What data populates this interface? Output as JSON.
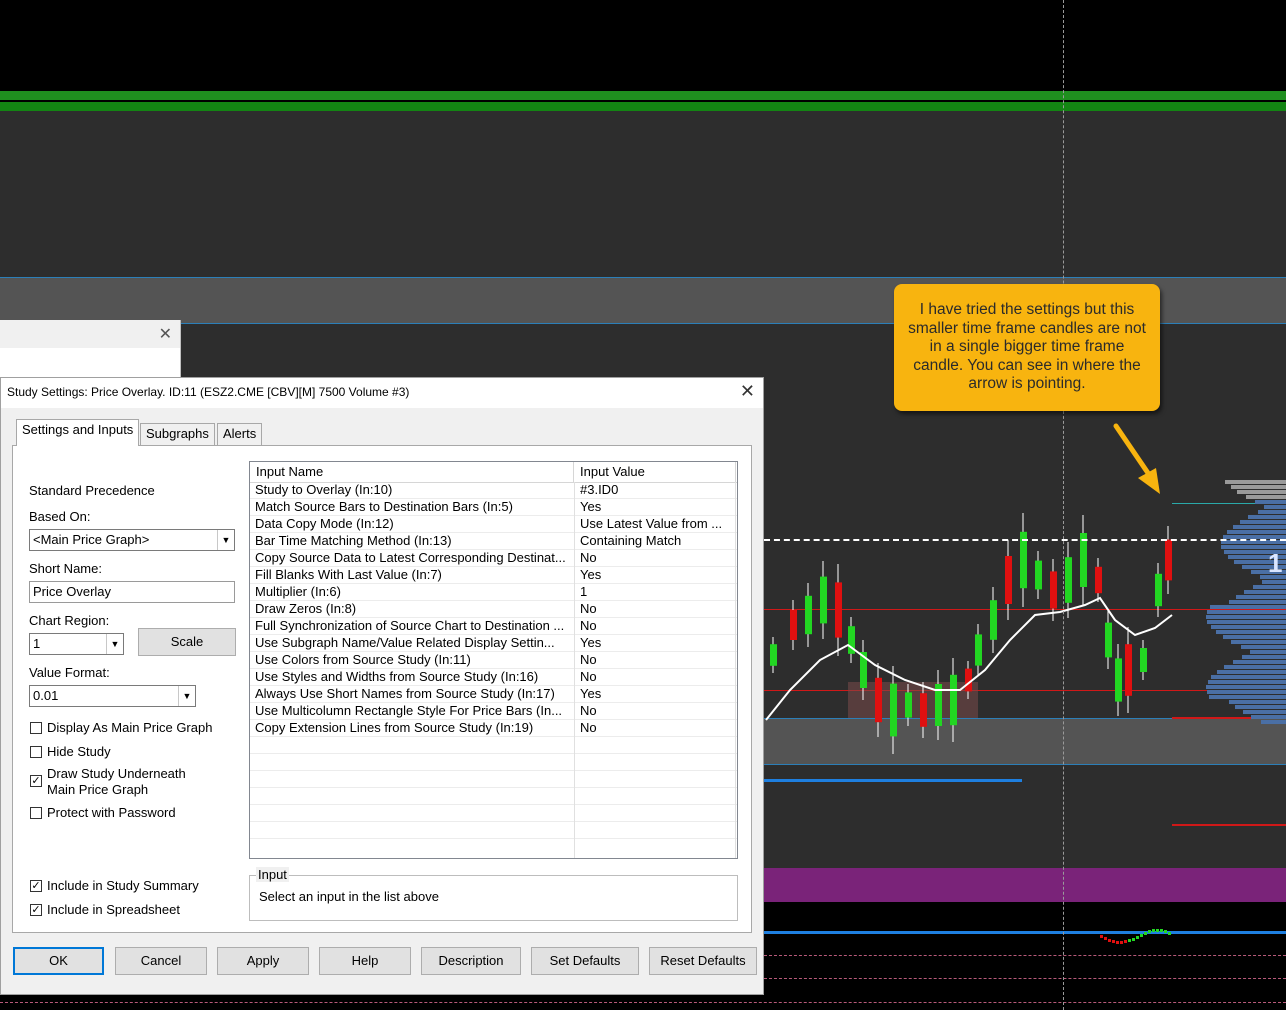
{
  "dialog": {
    "title": "Study Settings: Price Overlay. ID:11 (ESZ2.CME [CBV][M]  7500 Volume  #3)",
    "close_glyph": "✕",
    "tabs": [
      "Settings and Inputs",
      "Subgraphs",
      "Alerts"
    ],
    "active_tab": "Settings and Inputs",
    "standard_precedence_label": "Standard Precedence",
    "based_on_label": "Based On:",
    "based_on_value": "<Main Price Graph>",
    "short_name_label": "Short Name:",
    "short_name_value": "Price Overlay",
    "chart_region_label": "Chart Region:",
    "chart_region_value": "1",
    "scale_button": "Scale",
    "value_format_label": "Value Format:",
    "value_format_value": "0.01",
    "checkboxes": [
      {
        "label": "Display As Main Price Graph",
        "checked": false
      },
      {
        "label": "Hide Study",
        "checked": false
      },
      {
        "label": "Draw Study Underneath Main Price Graph",
        "line1": "Draw Study Underneath",
        "line2": "Main Price Graph",
        "checked": true
      },
      {
        "label": "Protect with Password",
        "checked": false
      },
      {
        "label": "Include in Study Summary",
        "checked": true
      },
      {
        "label": "Include in Spreadsheet",
        "checked": true
      }
    ],
    "input_list": {
      "headers": [
        "Input Name",
        "Input Value"
      ],
      "rows": [
        {
          "name": "Study to Overlay  (In:10)",
          "value": "#3.ID0"
        },
        {
          "name": "Match Source Bars to Destination Bars  (In:5)",
          "value": "Yes"
        },
        {
          "name": "Data Copy Mode  (In:12)",
          "value": "Use Latest Value from ..."
        },
        {
          "name": "Bar Time Matching Method  (In:13)",
          "value": "Containing Match"
        },
        {
          "name": "Copy Source Data to Latest Corresponding Destinat...",
          "value": "No"
        },
        {
          "name": "Fill Blanks With Last Value  (In:7)",
          "value": "Yes"
        },
        {
          "name": "Multiplier  (In:6)",
          "value": "1"
        },
        {
          "name": "Draw Zeros  (In:8)",
          "value": "No"
        },
        {
          "name": "Full Synchronization of Source Chart to Destination  ...",
          "value": "No"
        },
        {
          "name": "Use Subgraph Name/Value Related Display Settin...",
          "value": "Yes"
        },
        {
          "name": "Use Colors from Source Study  (In:11)",
          "value": "No"
        },
        {
          "name": "Use Styles and Widths from Source Study  (In:16)",
          "value": "No"
        },
        {
          "name": "Always Use Short Names from Source Study  (In:17)",
          "value": "Yes"
        },
        {
          "name": "Use Multicolumn Rectangle Style For Price Bars  (In...",
          "value": "No"
        },
        {
          "name": "Copy Extension Lines from Source Study  (In:19)",
          "value": "No"
        }
      ],
      "empty_rows": 6
    },
    "input_group_label": "Input",
    "input_group_hint": "Select an input in the list above",
    "buttons": [
      "OK",
      "Cancel",
      "Apply",
      "Help",
      "Description",
      "Set Defaults",
      "Reset Defaults"
    ]
  },
  "background_window": {
    "close_glyph": "✕"
  },
  "callout": {
    "text": "I have tried the settings but this smaller time frame candles are not in a single bigger time frame candle. You can see in where the arrow is pointing."
  },
  "chart": {
    "partial_number": "1",
    "colors": {
      "background": "#2d2d2d",
      "up_candle": "#22d622",
      "down_candle": "#e01010",
      "moving_average": "#ffffff",
      "band_green": "#1f8f1f",
      "purple_band": "#7a2379",
      "blue_line": "#1e7fe0",
      "callout": "#f8b40f"
    }
  }
}
